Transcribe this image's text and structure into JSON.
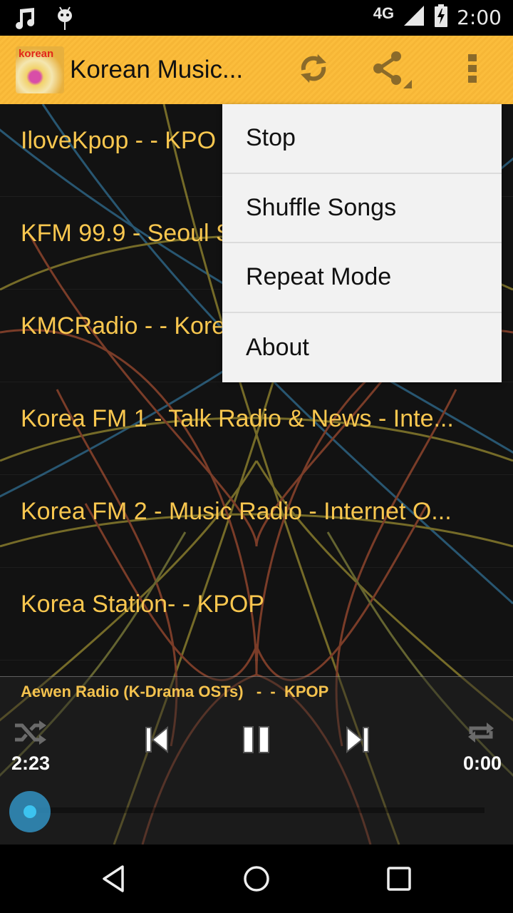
{
  "status_bar": {
    "left_icons": [
      "music-note-icon",
      "android-icon"
    ],
    "network": "4G",
    "time": "2:00"
  },
  "app_bar": {
    "logo_text": "korean",
    "title": "Korean Music...",
    "actions": [
      "refresh-icon",
      "share-icon",
      "overflow-menu-icon"
    ],
    "color": "#fbbd3c"
  },
  "stations": [
    {
      "label": "IloveKpop  - - KPO"
    },
    {
      "label": "KFM 99.9 - Seoul S"
    },
    {
      "label": "KMCRadio - - Kore"
    },
    {
      "label": "Korea FM 1 - Talk Radio & News - Inte..."
    },
    {
      "label": "Korea FM 2 - Music Radio - Internet O..."
    },
    {
      "label": "Korea Station- - KPOP"
    }
  ],
  "overflow_menu": {
    "items": [
      {
        "label": "Stop"
      },
      {
        "label": "Shuffle Songs"
      },
      {
        "label": "Repeat Mode"
      },
      {
        "label": "About"
      }
    ]
  },
  "player": {
    "now_playing": "Aewen Radio (K-Drama OSTs)   -  -  KPOP",
    "elapsed": "2:23",
    "total": "0:00",
    "progress_fraction": 0.0,
    "text_color": "#f4c24e",
    "controls": [
      "shuffle-icon",
      "previous-icon",
      "pause-icon",
      "next-icon",
      "repeat-icon"
    ]
  },
  "nav_bar": {
    "buttons": [
      "back",
      "home",
      "recents"
    ]
  }
}
